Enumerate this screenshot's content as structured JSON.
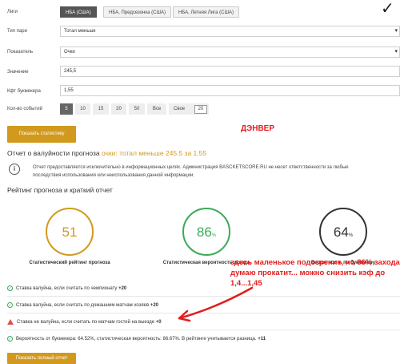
{
  "form": {
    "leagues_label": "Лиги",
    "leagues": [
      "НБА (США)",
      "НБА, Предсезонка (США)",
      "НБА, Летняя Лига (США)"
    ],
    "bet_type_label": "Тип пари",
    "bet_type_value": "Тотал меньше",
    "indicator_label": "Показатель",
    "indicator_value": "Очки",
    "value_label": "Значение",
    "value_value": "245,5",
    "odds_label": "Кфт букмекера",
    "odds_value": "1,55",
    "events_label": "Кол-во событий",
    "events_options": [
      "5",
      "10",
      "15",
      "20",
      "50",
      "Все",
      "Свое"
    ],
    "events_custom": "20",
    "show_stats_button": "Показать статистику"
  },
  "annotations": {
    "denver": "ДЭНВЕР",
    "suspicion": "здесь маленькое подозрение, но 86% захода думаю прокатит... можно снизить кэф до 1,4...1,45",
    "checkmark": "✓"
  },
  "report": {
    "title_prefix": "Отчет о валуйности прогноза",
    "title_highlight": "очки: тотал меньше 245.5 за 1.55",
    "disclaimer": "Отчет предоставляется исключительно в информационных целях. Администрация BASCKETSCORE.RU не несет ответственности за любые последствия использования или неиспользования данной информации.",
    "rating_heading": "Рейтинг прогноза и краткий отчет",
    "gauges": [
      {
        "value": "51",
        "unit": "",
        "caption": "Статистический рейтинг прогноза",
        "color": "#d19a1e",
        "level": 0.51
      },
      {
        "value": "86",
        "unit": "%",
        "caption": "Статистическая вероятность захода",
        "color": "#3caa5a",
        "level": 0.86
      },
      {
        "value": "64",
        "unit": "%",
        "caption": "Вероятность по букмекеру",
        "color": "#333333",
        "level": 0.64
      }
    ],
    "lines": [
      {
        "text": "Ставка валуйна, если считать по чемпионату",
        "bold": "+20"
      },
      {
        "text": "Ставка валуйна, если считать по домашним матчам хозяев",
        "bold": "+20"
      },
      {
        "text": "Ставка не валуйна, если считать по матчам гостей на выезде",
        "bold": "+0"
      },
      {
        "text": "Вероятность от букмекера: 64.52%, статистическая вероятность: 86.67%. В рейтинге учитывается разница.",
        "bold": "+11"
      }
    ],
    "full_report_button": "Показать полный отчет"
  }
}
